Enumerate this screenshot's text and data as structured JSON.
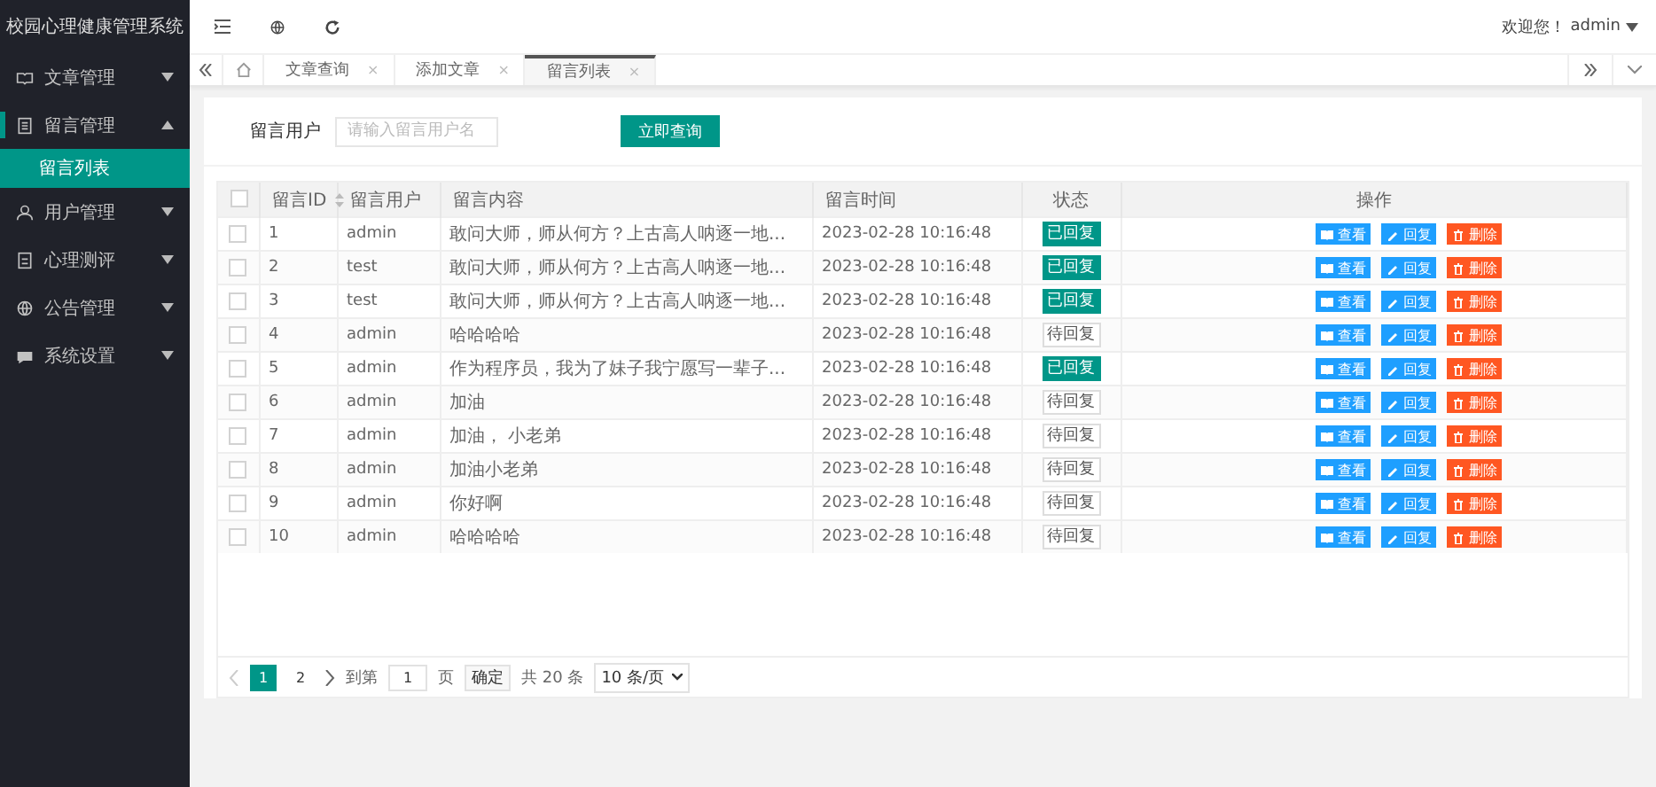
{
  "app_title": "校园心理健康管理系统",
  "sidebar": {
    "items": [
      {
        "label": "文章管理",
        "expanded": false,
        "selected": false
      },
      {
        "label": "留言管理",
        "expanded": true,
        "selected": true,
        "children": [
          {
            "label": "留言列表",
            "selected": true
          }
        ]
      },
      {
        "label": "用户管理",
        "expanded": false,
        "selected": false
      },
      {
        "label": "心理测评",
        "expanded": false,
        "selected": false
      },
      {
        "label": "公告管理",
        "expanded": false,
        "selected": false
      },
      {
        "label": "系统设置",
        "expanded": false,
        "selected": false
      }
    ]
  },
  "header": {
    "welcome": "欢迎您！",
    "user": "admin"
  },
  "tabs": [
    {
      "label": "文章查询",
      "close": "×",
      "selected": false
    },
    {
      "label": "添加文章",
      "close": "×",
      "selected": false
    },
    {
      "label": "留言列表",
      "close": "×",
      "selected": true
    }
  ],
  "search": {
    "label": "留言用户",
    "placeholder": "请输入留言用户名",
    "button": "立即查询"
  },
  "table": {
    "all_checked": false,
    "columns": [
      "留言ID",
      "留言用户",
      "留言内容",
      "留言时间",
      "状态",
      "操作"
    ],
    "rows": [
      {
        "id": "1",
        "user": "admin",
        "content": "敢问大师，师从何方？上古高人呐逐一地...",
        "time": "2023-02-28 10:16:48",
        "status": "已回复",
        "replied": true,
        "checked": false,
        "actions": [
          "查看",
          "回复",
          "删除"
        ]
      },
      {
        "id": "2",
        "user": "test",
        "content": "敢问大师，师从何方？上古高人呐逐一地...",
        "time": "2023-02-28 10:16:48",
        "status": "已回复",
        "replied": true,
        "checked": false,
        "actions": [
          "查看",
          "回复",
          "删除"
        ]
      },
      {
        "id": "3",
        "user": "test",
        "content": "敢问大师，师从何方？上古高人呐逐一地...",
        "time": "2023-02-28 10:16:48",
        "status": "已回复",
        "replied": true,
        "checked": false,
        "actions": [
          "查看",
          "回复",
          "删除"
        ]
      },
      {
        "id": "4",
        "user": "admin",
        "content": "哈哈哈哈",
        "time": "2023-02-28 10:16:48",
        "status": "待回复",
        "replied": false,
        "checked": false,
        "actions": [
          "查看",
          "回复",
          "删除"
        ]
      },
      {
        "id": "5",
        "user": "admin",
        "content": "作为程序员，我为了妹子我宁愿写一辈子...",
        "time": "2023-02-28 10:16:48",
        "status": "已回复",
        "replied": true,
        "checked": false,
        "actions": [
          "查看",
          "回复",
          "删除"
        ]
      },
      {
        "id": "6",
        "user": "admin",
        "content": "加油",
        "time": "2023-02-28 10:16:48",
        "status": "待回复",
        "replied": false,
        "checked": false,
        "actions": [
          "查看",
          "回复",
          "删除"
        ]
      },
      {
        "id": "7",
        "user": "admin",
        "content": "加油，  小老弟",
        "time": "2023-02-28 10:16:48",
        "status": "待回复",
        "replied": false,
        "checked": false,
        "actions": [
          "查看",
          "回复",
          "删除"
        ]
      },
      {
        "id": "8",
        "user": "admin",
        "content": "加油小老弟",
        "time": "2023-02-28 10:16:48",
        "status": "待回复",
        "replied": false,
        "checked": false,
        "actions": [
          "查看",
          "回复",
          "删除"
        ]
      },
      {
        "id": "9",
        "user": "admin",
        "content": "你好啊",
        "time": "2023-02-28 10:16:48",
        "status": "待回复",
        "replied": false,
        "checked": false,
        "actions": [
          "查看",
          "回复",
          "删除"
        ]
      },
      {
        "id": "10",
        "user": "admin",
        "content": "哈哈哈哈",
        "time": "2023-02-28 10:16:48",
        "status": "待回复",
        "replied": false,
        "checked": false,
        "actions": [
          "查看",
          "回复",
          "删除"
        ]
      }
    ]
  },
  "pagination": {
    "pages": [
      {
        "label": "1",
        "selected": true
      },
      {
        "label": "2",
        "selected": false
      }
    ],
    "goto_label": "到第",
    "goto_value": "1",
    "page_unit": "页",
    "confirm": "确定",
    "total": "共 20 条",
    "page_size": "10 条/页"
  }
}
